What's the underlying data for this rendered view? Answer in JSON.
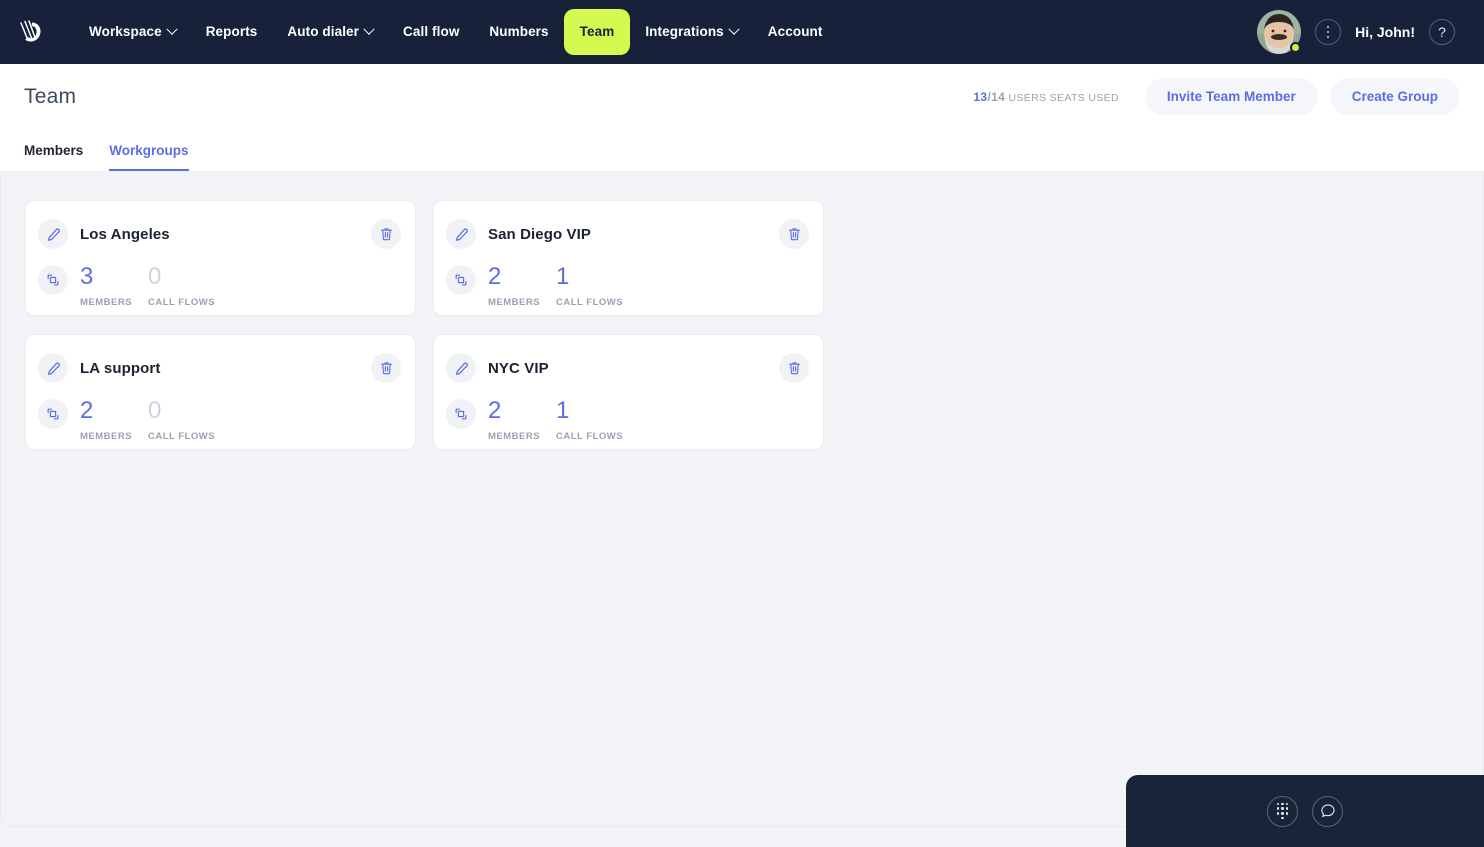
{
  "navbar": {
    "logo_name": "kixie-hand-logo",
    "links": [
      {
        "label": "Workspace",
        "has_caret": true,
        "active": false
      },
      {
        "label": "Reports",
        "has_caret": false,
        "active": false
      },
      {
        "label": "Auto dialer",
        "has_caret": true,
        "active": false
      },
      {
        "label": "Call flow",
        "has_caret": false,
        "active": false
      },
      {
        "label": "Numbers",
        "has_caret": false,
        "active": false
      },
      {
        "label": "Team",
        "has_caret": false,
        "active": true
      },
      {
        "label": "Integrations",
        "has_caret": true,
        "active": false
      },
      {
        "label": "Account",
        "has_caret": false,
        "active": false
      }
    ],
    "greeting": "Hi, John!",
    "help_label": "?",
    "active_pill_color": "#d6f94f",
    "background_color": "#17223a",
    "status_dot_color": "#cdef3e"
  },
  "header": {
    "title": "Team",
    "seats": {
      "used": "13",
      "separator": "/",
      "total": "14",
      "label": "USERS SEATS USED"
    },
    "invite_button": "Invite Team Member",
    "create_group_button": "Create Group",
    "accent_color": "#5c6ee0"
  },
  "tabs": [
    {
      "label": "Members",
      "active": false
    },
    {
      "label": "Workgroups",
      "active": true
    }
  ],
  "workgroups": [
    {
      "name": "Los Angeles",
      "members": {
        "value": "3",
        "label": "MEMBERS"
      },
      "call_flows": {
        "value": "0",
        "label": "CALL FLOWS"
      }
    },
    {
      "name": "San Diego VIP",
      "members": {
        "value": "2",
        "label": "MEMBERS"
      },
      "call_flows": {
        "value": "1",
        "label": "CALL FLOWS"
      }
    },
    {
      "name": "LA support",
      "members": {
        "value": "2",
        "label": "MEMBERS"
      },
      "call_flows": {
        "value": "0",
        "label": "CALL FLOWS"
      }
    },
    {
      "name": "NYC VIP",
      "members": {
        "value": "2",
        "label": "MEMBERS"
      },
      "call_flows": {
        "value": "1",
        "label": "CALL FLOWS"
      }
    }
  ],
  "chat_widget": {
    "dialpad_icon": "dialpad-icon",
    "chat_icon": "chat-bubble-icon",
    "background_color": "#1a2438"
  }
}
